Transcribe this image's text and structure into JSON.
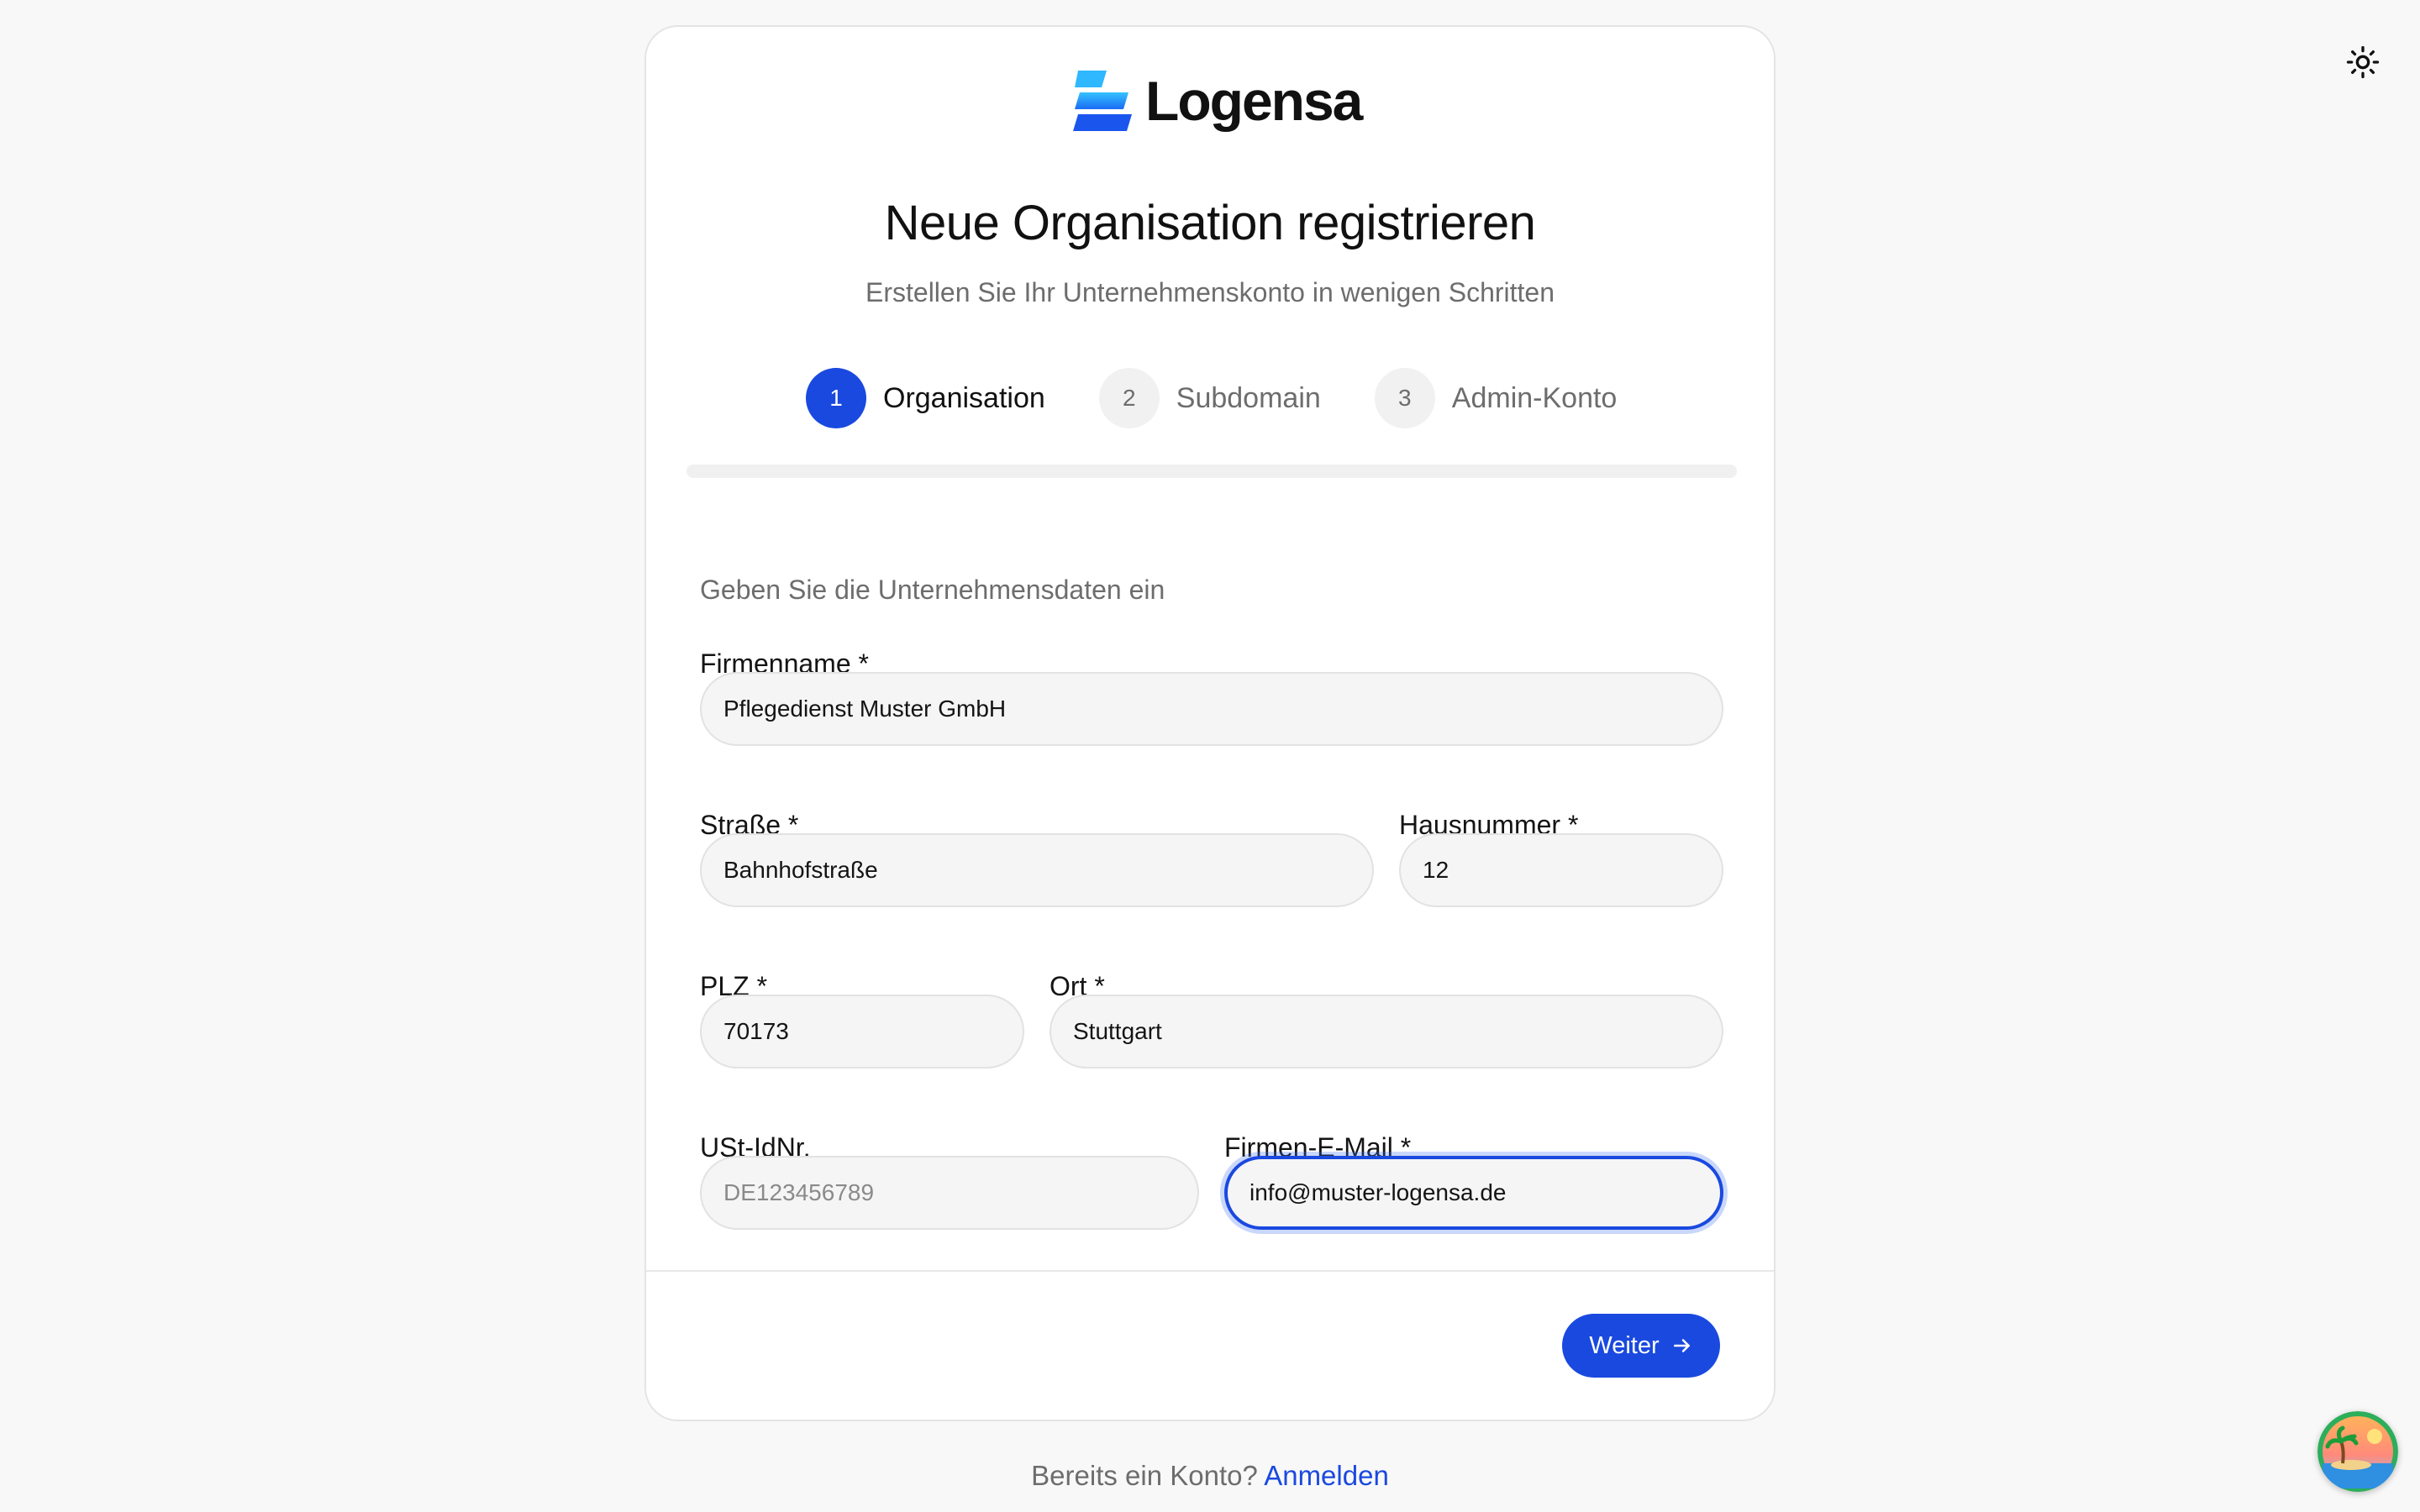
{
  "theme_toggle": {
    "icon": "sun-icon"
  },
  "brand": {
    "name": "Logensa",
    "colors": {
      "primary": "#1a49e0",
      "logo_light": "#2fb2ff"
    }
  },
  "header": {
    "title": "Neue Organisation registrieren",
    "subtitle": "Erstellen Sie Ihr Unternehmenskonto in wenigen Schritten"
  },
  "stepper": {
    "steps": [
      {
        "number": "1",
        "label": "Organisation",
        "active": true
      },
      {
        "number": "2",
        "label": "Subdomain",
        "active": false
      },
      {
        "number": "3",
        "label": "Admin-Konto",
        "active": false
      }
    ]
  },
  "form": {
    "description": "Geben Sie die Unternehmensdaten ein",
    "company_name": {
      "label": "Firmenname *",
      "value": "Pflegedienst Muster GmbH"
    },
    "street": {
      "label": "Straße *",
      "value": "Bahnhofstraße"
    },
    "house_number": {
      "label": "Hausnummer *",
      "value": "12"
    },
    "zip": {
      "label": "PLZ *",
      "value": "70173"
    },
    "city": {
      "label": "Ort *",
      "value": "Stuttgart"
    },
    "vat_id": {
      "label": "USt-IdNr.",
      "value": "",
      "placeholder": "DE123456789"
    },
    "email": {
      "label": "Firmen-E-Mail *",
      "value": "info@muster-logensa.de"
    }
  },
  "actions": {
    "next_label": "Weiter",
    "next_icon": "arrow-right-icon"
  },
  "footer": {
    "prompt": "Bereits ein Konto?",
    "login_link": "Anmelden"
  }
}
